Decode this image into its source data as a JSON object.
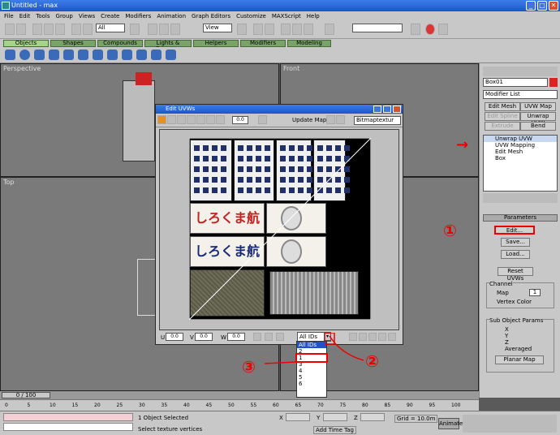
{
  "window": {
    "title": "Untitled - max",
    "min": "_",
    "max": "□",
    "close": "✕"
  },
  "menu": [
    "File",
    "Edit",
    "Tools",
    "Group",
    "Views",
    "Create",
    "Modifiers",
    "Animation",
    "Graph Editors",
    "Customize",
    "MAXScript",
    "Help"
  ],
  "toolbar": {
    "selection_filter": "All",
    "ref_coord": "View"
  },
  "tabs": [
    "Objects",
    "Shapes",
    "Compounds",
    "Lights & Cameras",
    "Helpers",
    "Modifiers",
    "Modeling"
  ],
  "viewports": {
    "top_left": "Perspective",
    "top_right": "Front",
    "bottom_left": "Top"
  },
  "cmd_panel": {
    "object_name": "Box01",
    "modifier_list": "Modifier List",
    "buttons": [
      "Edit Mesh",
      "UVW Map",
      "Edit Spline",
      "Unwrap UVW",
      "Extrude",
      "Bend"
    ],
    "stack": [
      "Unwrap UVW",
      "UVW Mapping",
      "Edit Mesh",
      "Box"
    ],
    "rollout_title": "Parameters",
    "param_buttons": [
      "Edit...",
      "Save...",
      "Load...",
      "Reset UVWs"
    ],
    "channel_label": "Channel",
    "map_label": "Map",
    "map_value": "1",
    "vertex_color_label": "Vertex Color",
    "subobj_title": "Sub Object Params",
    "axes": [
      "X",
      "Y",
      "Z",
      "Averaged"
    ],
    "planar_map": "Planar Map"
  },
  "uvw": {
    "title": "Edit UVWs",
    "spin_value": "0.0",
    "update_map": "Update Map",
    "texture_dropdown": "Bitmaptextur",
    "u_label": "U",
    "v_label": "V",
    "w_label": "W",
    "u_value": "0.0",
    "v_value": "0.0",
    "w_value": "0.0",
    "ids_dropdown": "All IDs",
    "texture_text": "しろくま航空"
  },
  "ids_list": [
    "All IDs",
    "2",
    "1",
    "3",
    "4",
    "5",
    "6"
  ],
  "annotations": {
    "one": "①",
    "two": "②",
    "three": "③",
    "arrow": "→"
  },
  "timeline": {
    "frame": "0 / 100",
    "ticks": [
      "0",
      "5",
      "10",
      "15",
      "20",
      "25",
      "30",
      "35",
      "40",
      "45",
      "50",
      "55",
      "60",
      "65",
      "70",
      "75",
      "80",
      "85",
      "90",
      "95",
      "100"
    ]
  },
  "status": {
    "selected": "1 Object Selected",
    "prompt": "Select texture vertices",
    "x_label": "X",
    "y_label": "Y",
    "z_label": "Z",
    "grid": "Grid = 10.0m",
    "add_time_tag": "Add Time Tag",
    "animate": "Animate"
  },
  "colors": {
    "title_blue": "#1d55c9",
    "panel_gray": "#c8c8c8",
    "annotation_red": "#e00000"
  }
}
